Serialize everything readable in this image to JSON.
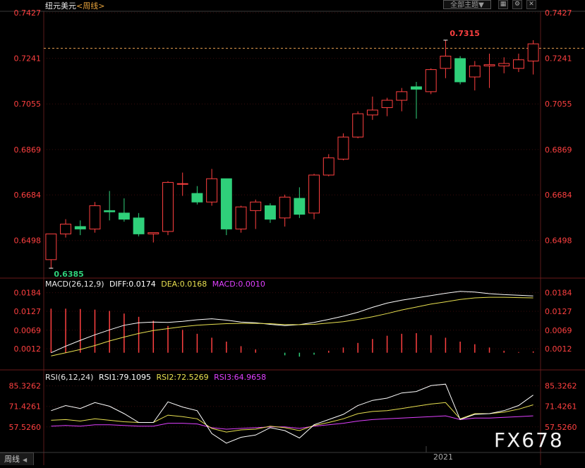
{
  "header": {
    "symbol": "纽元美元",
    "period_label": "<周线>",
    "theme_button": "全部主题▼",
    "tool_icons": [
      "grid-icon",
      "settings-icon",
      "close-icon"
    ]
  },
  "colors": {
    "up": "#ff4040",
    "down": "#2fd07a",
    "axis_label": "#ff4040",
    "grid": "#3a0d0d",
    "macd_diff": "#ffffff",
    "macd_dea": "#e8e050",
    "macd_bar": "#ff4040",
    "rsi1": "#ffffff",
    "rsi2": "#e8e050",
    "rsi3": "#e040ff",
    "dotted_line": "#e8a050"
  },
  "chart_data": [
    {
      "type": "candlestick",
      "title": "纽元美元<周线>",
      "ylim": [
        0.6385,
        0.7427
      ],
      "y_ticks": [
        "0.7427",
        "0.7241",
        "0.7055",
        "0.6869",
        "0.6684",
        "0.6498"
      ],
      "annotations": {
        "high": "0.7315",
        "low": "0.6385"
      },
      "reference_line": 0.7282,
      "candles": [
        {
          "o": 0.642,
          "h": 0.6525,
          "l": 0.6385,
          "c": 0.6525
        },
        {
          "o": 0.6525,
          "h": 0.6585,
          "l": 0.651,
          "c": 0.6565
        },
        {
          "o": 0.6555,
          "h": 0.658,
          "l": 0.652,
          "c": 0.6545
        },
        {
          "o": 0.6545,
          "h": 0.6655,
          "l": 0.653,
          "c": 0.664
        },
        {
          "o": 0.662,
          "h": 0.67,
          "l": 0.658,
          "c": 0.6615
        },
        {
          "o": 0.661,
          "h": 0.667,
          "l": 0.6575,
          "c": 0.6585
        },
        {
          "o": 0.659,
          "h": 0.661,
          "l": 0.6515,
          "c": 0.6525
        },
        {
          "o": 0.6525,
          "h": 0.653,
          "l": 0.649,
          "c": 0.653
        },
        {
          "o": 0.6535,
          "h": 0.674,
          "l": 0.652,
          "c": 0.6735
        },
        {
          "o": 0.673,
          "h": 0.6775,
          "l": 0.668,
          "c": 0.673
        },
        {
          "o": 0.669,
          "h": 0.672,
          "l": 0.6645,
          "c": 0.6655
        },
        {
          "o": 0.6655,
          "h": 0.679,
          "l": 0.664,
          "c": 0.675
        },
        {
          "o": 0.675,
          "h": 0.675,
          "l": 0.652,
          "c": 0.6545
        },
        {
          "o": 0.6545,
          "h": 0.664,
          "l": 0.653,
          "c": 0.6635
        },
        {
          "o": 0.662,
          "h": 0.6665,
          "l": 0.6545,
          "c": 0.6655
        },
        {
          "o": 0.664,
          "h": 0.665,
          "l": 0.657,
          "c": 0.6585
        },
        {
          "o": 0.659,
          "h": 0.6685,
          "l": 0.6555,
          "c": 0.6675
        },
        {
          "o": 0.667,
          "h": 0.6715,
          "l": 0.659,
          "c": 0.6605
        },
        {
          "o": 0.661,
          "h": 0.677,
          "l": 0.6585,
          "c": 0.6765
        },
        {
          "o": 0.6765,
          "h": 0.685,
          "l": 0.676,
          "c": 0.6835
        },
        {
          "o": 0.683,
          "h": 0.6935,
          "l": 0.6825,
          "c": 0.692
        },
        {
          "o": 0.692,
          "h": 0.7025,
          "l": 0.6915,
          "c": 0.7015
        },
        {
          "o": 0.701,
          "h": 0.7085,
          "l": 0.699,
          "c": 0.703
        },
        {
          "o": 0.704,
          "h": 0.708,
          "l": 0.7005,
          "c": 0.707
        },
        {
          "o": 0.707,
          "h": 0.712,
          "l": 0.7025,
          "c": 0.7105
        },
        {
          "o": 0.7125,
          "h": 0.7145,
          "l": 0.6995,
          "c": 0.7115
        },
        {
          "o": 0.7105,
          "h": 0.72,
          "l": 0.7095,
          "c": 0.7195
        },
        {
          "o": 0.72,
          "h": 0.7315,
          "l": 0.716,
          "c": 0.725
        },
        {
          "o": 0.724,
          "h": 0.725,
          "l": 0.7135,
          "c": 0.7145
        },
        {
          "o": 0.7165,
          "h": 0.723,
          "l": 0.711,
          "c": 0.721
        },
        {
          "o": 0.721,
          "h": 0.726,
          "l": 0.712,
          "c": 0.7215
        },
        {
          "o": 0.721,
          "h": 0.7245,
          "l": 0.718,
          "c": 0.722
        },
        {
          "o": 0.72,
          "h": 0.726,
          "l": 0.7185,
          "c": 0.7235
        },
        {
          "o": 0.723,
          "h": 0.7315,
          "l": 0.7175,
          "c": 0.73
        }
      ]
    },
    {
      "type": "line",
      "title": "MACD(26,12,9)",
      "labels": {
        "diff": "DIFF:0.0174",
        "dea": "DEA:0.0168",
        "macd": "MACD:0.0010"
      },
      "ylim": [
        -0.0018,
        0.0194
      ],
      "y_ticks": [
        "0.0184",
        "0.0127",
        "0.0069",
        "0.0012"
      ],
      "macd_bars": [
        0.0135,
        0.0135,
        0.0134,
        0.0132,
        0.0128,
        0.012,
        0.011,
        0.0098,
        0.0082,
        0.007,
        0.0058,
        0.0046,
        0.0034,
        0.002,
        0.001,
        0.0,
        -0.0008,
        -0.0012,
        -0.0006,
        0.0006,
        0.0016,
        0.003,
        0.0042,
        0.0052,
        0.0058,
        0.006,
        0.0054,
        0.0046,
        0.0034,
        0.0026,
        0.0016,
        0.0006,
        0.0002,
        0.0004
      ],
      "diff": [
        0.0,
        0.002,
        0.0038,
        0.0055,
        0.007,
        0.0084,
        0.0092,
        0.0094,
        0.0093,
        0.0096,
        0.0101,
        0.0104,
        0.01,
        0.0094,
        0.0092,
        0.0087,
        0.0083,
        0.0086,
        0.0093,
        0.0102,
        0.0112,
        0.0124,
        0.0139,
        0.0152,
        0.0161,
        0.0168,
        0.0175,
        0.0182,
        0.0188,
        0.0186,
        0.0181,
        0.0178,
        0.0176,
        0.0174
      ],
      "dea": [
        -0.001,
        0.0,
        0.001,
        0.0022,
        0.0036,
        0.0048,
        0.0059,
        0.0068,
        0.0074,
        0.008,
        0.0084,
        0.0087,
        0.0089,
        0.009,
        0.009,
        0.0089,
        0.0086,
        0.0086,
        0.0087,
        0.0091,
        0.0095,
        0.0102,
        0.011,
        0.012,
        0.0131,
        0.014,
        0.0149,
        0.0156,
        0.0163,
        0.0168,
        0.017,
        0.017,
        0.0169,
        0.0168
      ]
    },
    {
      "type": "line",
      "title": "RSI(6,12,24)",
      "labels": {
        "rsi1": "RSI1:79.1095",
        "rsi2": "RSI2:72.5269",
        "rsi3": "RSI3:64.9658"
      },
      "ylim": [
        44.5,
        88.5
      ],
      "y_ticks": [
        "85.3262",
        "71.4261",
        "57.5260"
      ],
      "rsi1": [
        68.5,
        72.0,
        70.0,
        74.0,
        71.5,
        66.5,
        60.5,
        60.5,
        74.5,
        71.0,
        68.5,
        53.0,
        46.5,
        50.5,
        52.0,
        57.0,
        55.0,
        50.0,
        59.0,
        62.5,
        66.0,
        72.0,
        75.5,
        77.0,
        80.5,
        81.5,
        85.5,
        86.5,
        62.5,
        66.0,
        66.5,
        68.5,
        72.0,
        79.1
      ],
      "rsi2": [
        62.0,
        62.5,
        61.5,
        63.0,
        62.0,
        61.0,
        60.5,
        60.5,
        65.5,
        64.5,
        63.0,
        56.5,
        54.0,
        55.5,
        56.0,
        58.0,
        57.0,
        55.0,
        58.5,
        60.5,
        63.0,
        66.5,
        68.0,
        68.5,
        70.0,
        71.5,
        73.0,
        74.0,
        63.0,
        66.5,
        66.5,
        67.5,
        69.5,
        72.5
      ],
      "rsi3": [
        58.0,
        58.5,
        58.0,
        59.0,
        59.0,
        58.5,
        58.0,
        58.0,
        60.0,
        60.0,
        59.5,
        57.0,
        56.0,
        56.5,
        57.0,
        57.5,
        57.5,
        56.5,
        58.0,
        59.0,
        60.0,
        61.5,
        62.5,
        63.0,
        63.5,
        64.0,
        64.5,
        65.0,
        62.5,
        63.5,
        63.5,
        64.0,
        64.5,
        65.0
      ]
    }
  ],
  "footer": {
    "tab_label": "周线",
    "year_label": "2021",
    "watermark": "FX678"
  }
}
